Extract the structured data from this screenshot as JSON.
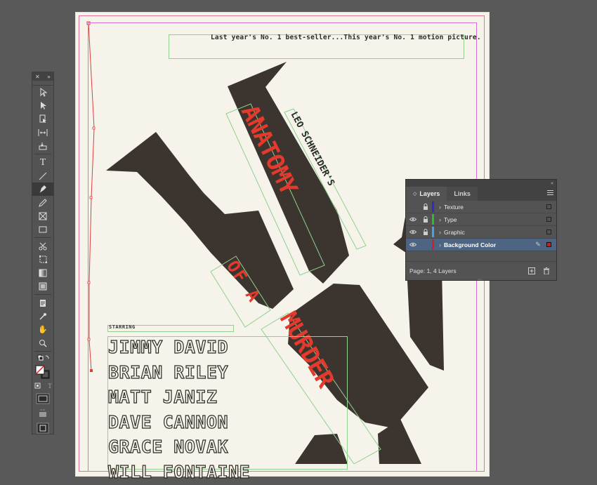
{
  "document": {
    "tagline": "Last year's No. 1 best-seller...This year's No. 1 motion picture.",
    "title_line_1": "ANATOMY",
    "title_line_2": "OF A",
    "title_line_3": "MURDER",
    "author": "LEO SCHNEIDER'S",
    "starring_label": "STARRING",
    "cast": [
      "JIMMY DAVID",
      "BRIAN RILEY",
      "MATT JANIZ",
      "DAVE CANNON",
      "GRACE NOVAK",
      "WILL FONTAINE"
    ],
    "colors": {
      "paper": "#f5f3ea",
      "silhouette": "#3b342f",
      "title_red": "#e23a2c"
    }
  },
  "tools_panel": {
    "collapse_label": "✕",
    "expand_label": "»",
    "tools": [
      {
        "name": "selection-tool-icon"
      },
      {
        "name": "direct-selection-tool-icon"
      },
      {
        "name": "page-tool-icon"
      },
      {
        "name": "gap-tool-icon"
      },
      {
        "name": "content-collector-tool-icon"
      },
      {
        "name": "type-tool-icon"
      },
      {
        "name": "line-tool-icon"
      },
      {
        "name": "pen-tool-icon"
      },
      {
        "name": "pencil-tool-icon"
      },
      {
        "name": "rectangle-frame-tool-icon"
      },
      {
        "name": "rectangle-tool-icon"
      },
      {
        "name": "scissors-tool-icon"
      },
      {
        "name": "free-transform-tool-icon"
      },
      {
        "name": "gradient-swatch-tool-icon"
      },
      {
        "name": "gradient-feather-tool-icon"
      },
      {
        "name": "note-tool-icon"
      },
      {
        "name": "eyedropper-tool-icon"
      },
      {
        "name": "hand-tool-icon"
      },
      {
        "name": "zoom-tool-icon"
      }
    ],
    "text_mode_glyph": "T"
  },
  "layers_panel": {
    "collapse_label": "«",
    "tabs": [
      {
        "label": "Layers",
        "active": true
      },
      {
        "label": "Links",
        "active": false
      }
    ],
    "layers": [
      {
        "name": "Texture",
        "visible": false,
        "locked": true,
        "color": "#2b2bd6",
        "selected": false
      },
      {
        "name": "Type",
        "visible": true,
        "locked": true,
        "color": "#22c422",
        "selected": false
      },
      {
        "name": "Graphic",
        "visible": true,
        "locked": true,
        "color": "#3da6f0",
        "selected": false
      },
      {
        "name": "Background Color",
        "visible": true,
        "locked": false,
        "color": "#d42020",
        "selected": true
      }
    ],
    "footer_text": "Page: 1, 4 Layers"
  }
}
